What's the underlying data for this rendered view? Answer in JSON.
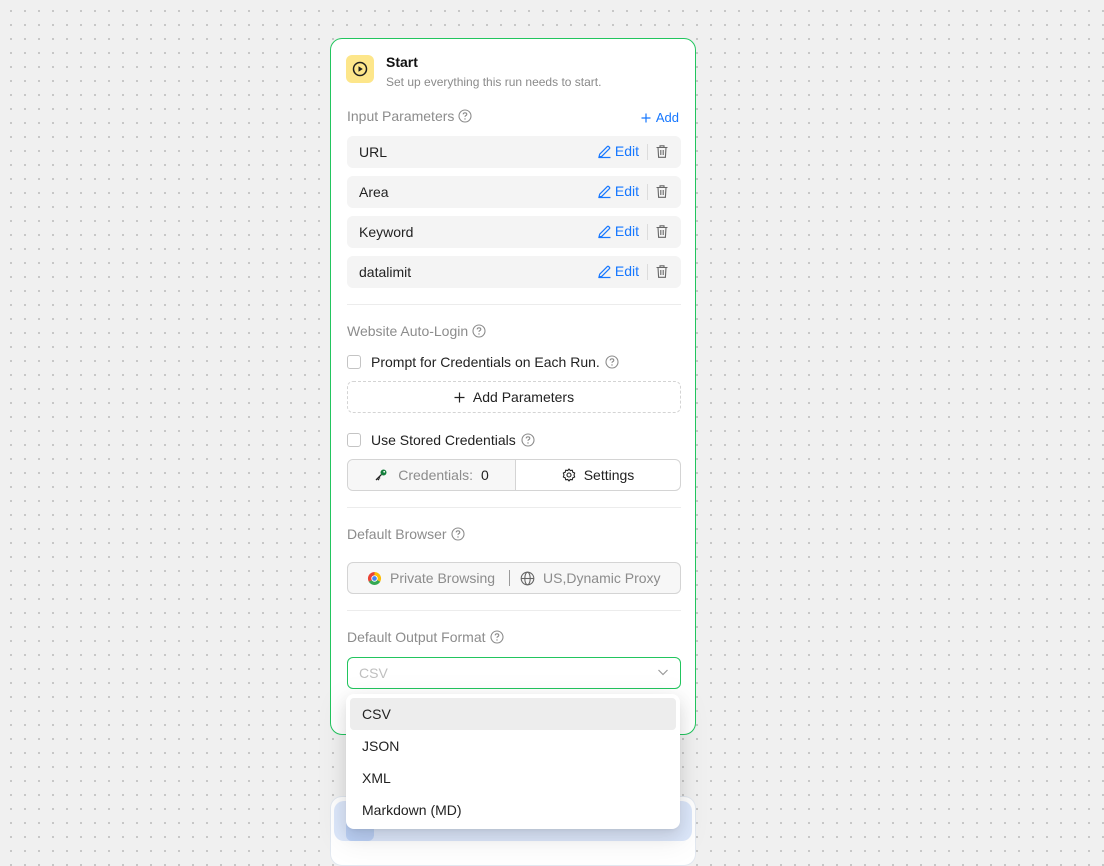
{
  "node": {
    "title": "Start",
    "subtitle": "Set up everything this run needs to start."
  },
  "input_parameters": {
    "label": "Input Parameters",
    "add_label": "Add",
    "edit_label": "Edit",
    "items": [
      {
        "name": "URL"
      },
      {
        "name": "Area"
      },
      {
        "name": "Keyword"
      },
      {
        "name": "datalimit"
      }
    ]
  },
  "auto_login": {
    "label": "Website Auto-Login",
    "prompt_credentials_label": "Prompt for Credentials on Each Run.",
    "prompt_credentials_checked": false,
    "add_parameters_label": "Add Parameters",
    "use_stored_label": "Use Stored Credentials",
    "use_stored_checked": false,
    "credentials_label": "Credentials:",
    "credentials_count": "0",
    "settings_label": "Settings"
  },
  "default_browser": {
    "label": "Default Browser",
    "browser": "Private Browsing",
    "proxy": "US,Dynamic Proxy"
  },
  "output_format": {
    "label": "Default Output Format",
    "selected": "CSV",
    "options": [
      "CSV",
      "JSON",
      "XML",
      "Markdown (MD)"
    ]
  },
  "icons": {
    "start": "play-circle-icon",
    "help": "question-circle-icon",
    "add": "plus-icon",
    "edit": "pencil-icon",
    "delete": "trash-icon",
    "key": "key-icon",
    "settings": "gear-icon",
    "browser": "chrome-icon",
    "proxy": "globe-icon",
    "dropdown": "chevron-down-icon"
  },
  "colors": {
    "accent": "#1677ff",
    "node_border": "#22c55e",
    "start_icon_bg": "#fde68a"
  }
}
